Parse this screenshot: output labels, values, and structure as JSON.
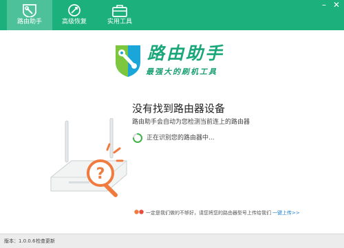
{
  "tabs": [
    {
      "label": "路由助手",
      "icon": "router-wrench-icon",
      "active": true
    },
    {
      "label": "高级恢复",
      "icon": "restore-icon",
      "active": false
    },
    {
      "label": "实用工具",
      "icon": "toolbox-icon",
      "active": false
    }
  ],
  "window_controls": {
    "minimize": "–",
    "close": "✕"
  },
  "logo": {
    "title": "路由助手",
    "subtitle": "最强大的刷机工具"
  },
  "message": {
    "title": "没有找到路由器设备",
    "subtitle": "路由助手会自动为您检测当前连上的路由器",
    "scanning": "正在识别您的路由器中..."
  },
  "footer_note": {
    "text": "一定是我们做的不够好，请您将您的路由器型号上传给我们",
    "link": "一键上传>>"
  },
  "statusbar": {
    "version": "版本：1.0.0.6",
    "check_update": "检查更新"
  },
  "colors": {
    "brand_green": "#1cb07d",
    "accent_orange": "#f07b3f",
    "link_blue": "#1a7fd0"
  }
}
